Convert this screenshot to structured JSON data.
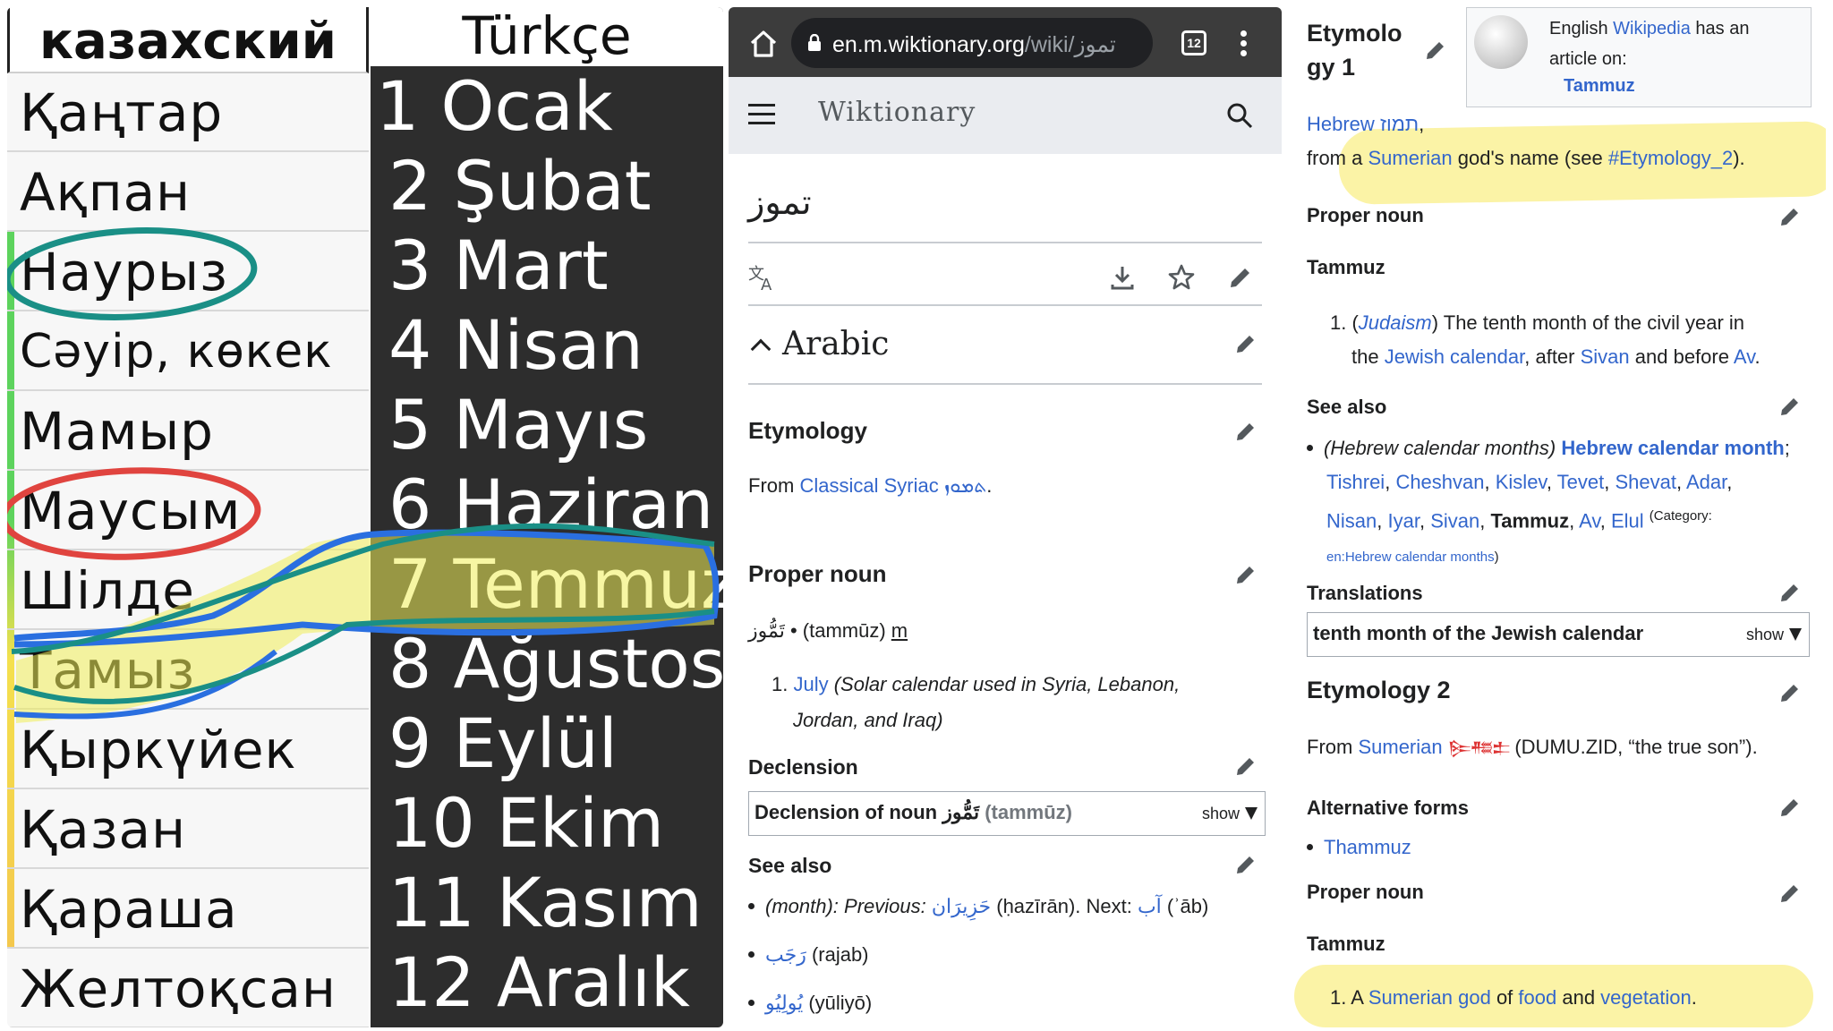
{
  "panel1": {
    "header_left": "казахский",
    "header_right": "Türkçe",
    "kazakh_months": [
      "Қаңтар",
      "Ақпан",
      "Наурыз",
      "Сәуір, көкек",
      "Мамыр",
      "Маусым",
      "Шілде",
      "Тамыз",
      "Қыркүйек",
      "Қазан",
      "Қараша",
      "Желтоқсан"
    ],
    "turkish_months": [
      "1 Ocak",
      "2 Şubat",
      "3 Mart",
      "4 Nisan",
      "5 Mayıs",
      "6 Haziran",
      "7 Temmuz",
      "8 Ağustos",
      "9 Eylül",
      "10 Ekim",
      "11 Kasım",
      "12 Aralık"
    ],
    "highlight_colors": {
      "teal": "#1a8f86",
      "red": "#e0443f",
      "yellow": "#f1ef57",
      "blue": "#2a6fe0"
    }
  },
  "panel2": {
    "url_host": "en.m.wiktionary.org",
    "url_path": "/wiki/تموز",
    "tab_count": "12",
    "site_title": "Wiktionary",
    "page_title": "تموز",
    "language": "Arabic",
    "etymology_heading": "Etymology",
    "etymology_prefix": "From ",
    "etymology_link": "Classical Syriac",
    "etymology_word": "ܬܡܘܙ",
    "etymology_suffix": ".",
    "pos_heading": "Proper noun",
    "headword": "تَمُّوز",
    "headword_rest": " • (tammūz) ",
    "gender": "m",
    "def_num": "1.",
    "def_link": "July",
    "def_text1": " (Solar calendar used in Syria, Lebanon,",
    "def_text2": "Jordan, and Iraq)",
    "declension_heading": "Declension",
    "declension_box_label": "Declension of noun تَمُّوز",
    "declension_box_translit": "(tammūz)",
    "show_label": "show",
    "see_also_heading": "See also",
    "see_also_1_pre": "(month): Previous: ",
    "see_also_1_prev": "حَزِيرَان",
    "see_also_1_prev_tr": " (ḥazīrān). Next: ",
    "see_also_1_next": "آب",
    "see_also_1_next_tr": " (ʾāb)",
    "see_also_2": "رَجَب",
    "see_also_2_tr": " (rajab)",
    "see_also_3": "يُولِيُو",
    "see_also_3_tr": " (yūliyō)"
  },
  "panel3": {
    "etym1_heading_a": "Etymolo",
    "etym1_heading_b": "gy 1",
    "wp_text_1": "English ",
    "wp_text_link": "Wikipedia",
    "wp_text_2": " has an",
    "wp_text_3": "article on:",
    "wp_article": "Tammuz",
    "etym1_line1_link": "Hebrew",
    "etym1_line1_word": "תמוז",
    "etym1_line1_end": ",",
    "etym1_line2_a": "from a ",
    "etym1_line2_link": "Sumerian",
    "etym1_line2_b": " god's name (see ",
    "etym1_line2_link2": "#Etymology_2",
    "etym1_line2_c": ").",
    "pos1_heading": "Proper noun",
    "pos1_headword": "Tammuz",
    "def1_num": "1. (",
    "def1_label": "Judaism",
    "def1_a": ") The tenth month of the civil year in",
    "def1_b_pre": "the ",
    "def1_b_link": "Jewish calendar",
    "def1_b_mid": ", after ",
    "def1_b_link2": "Sivan",
    "def1_b_mid2": " and before ",
    "def1_b_link3": "Av",
    "def1_b_end": ".",
    "see_also_heading": "See also",
    "sa_pre": "(Hebrew calendar months) ",
    "sa_bold_link": "Hebrew calendar month",
    "sa_semicolon": ";",
    "sa_months_line2": [
      "Tishrei",
      "Cheshvan",
      "Kislev",
      "Tevet",
      "Shevat",
      "Adar"
    ],
    "sa_months_line3": [
      "Nisan",
      "Iyar",
      "Sivan"
    ],
    "sa_tammuz": "Tammuz",
    "sa_months_line3b": [
      "Av",
      "Elul"
    ],
    "sa_category": "(Category:",
    "sa_category_link": "en:Hebrew calendar months",
    "sa_category_end": ")",
    "translations_heading": "Translations",
    "trans_box_label": "tenth month of the Jewish calendar",
    "show_label": "show",
    "etym2_heading": "Etymology 2",
    "etym2_a": "From ",
    "etym2_link": "Sumerian",
    "etym2_cuneiform": "𒌉𒍣𒉺",
    "etym2_b": " (DUMU.ZID, “the true son”).",
    "alt_forms_heading": "Alternative forms",
    "alt_form_1": "Thammuz",
    "pos2_heading": "Proper noun",
    "pos2_headword": "Tammuz",
    "def2_num": "1. A ",
    "def2_link1": "Sumerian",
    "def2_sp1": " ",
    "def2_link2": "god",
    "def2_of": " of ",
    "def2_link3": "food",
    "def2_and": " and ",
    "def2_link4": "vegetation",
    "def2_end": ".",
    "highlight_color": "#fbf3a6"
  }
}
